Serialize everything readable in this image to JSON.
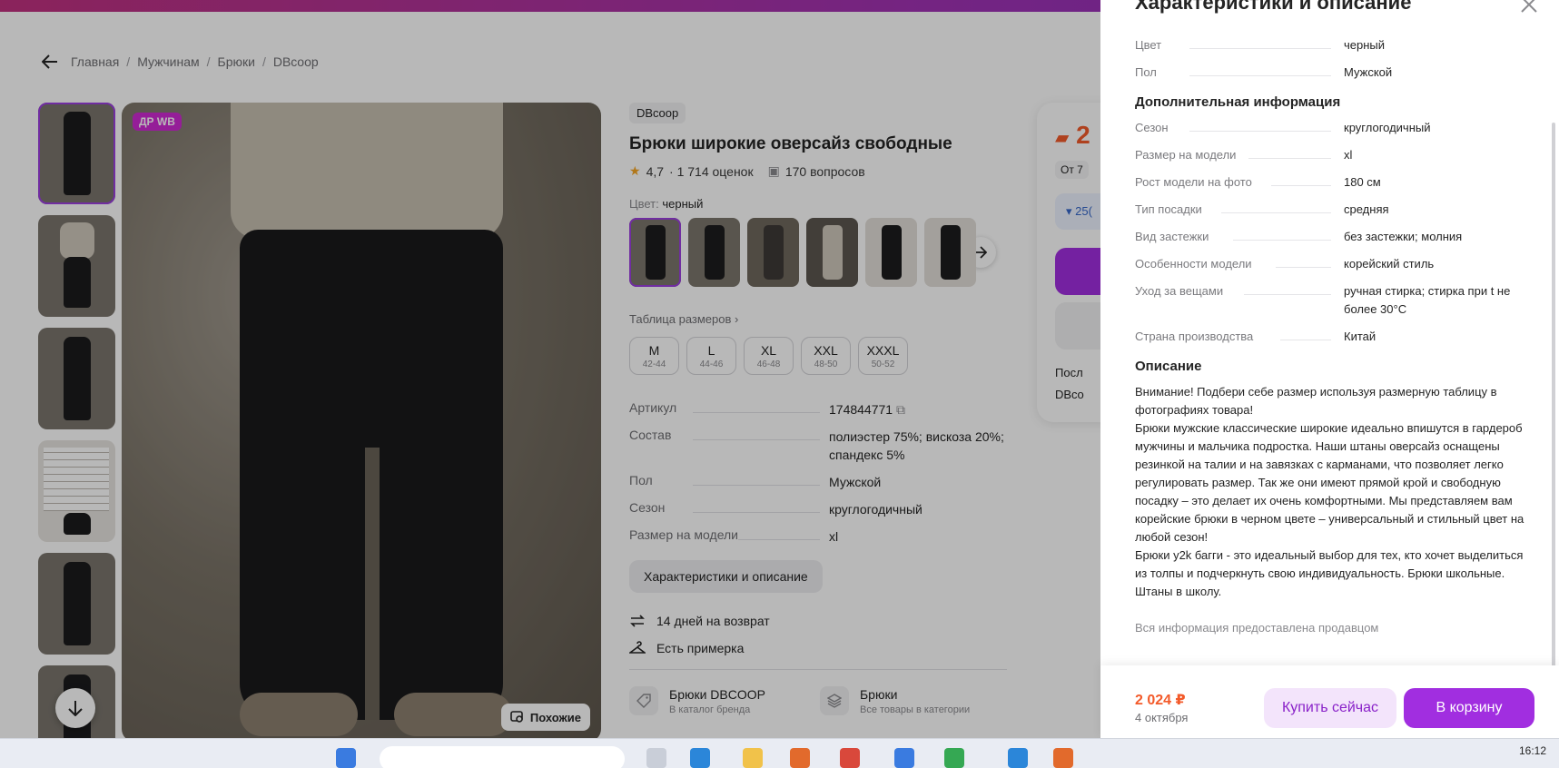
{
  "breadcrumb": [
    "Главная",
    "Мужчинам",
    "Брюки",
    "DBcoop"
  ],
  "gallery": {
    "badge": "ДР WB",
    "similar_label": "Похожие"
  },
  "product": {
    "brand": "DBcoop",
    "title": "Брюки широкие оверсайз свободные",
    "rating": "4,7",
    "reviews": "· 1 714 оценок",
    "questions": "170 вопросов",
    "color_label": "Цвет:",
    "color_value": "черный",
    "size_table_link": "Таблица размеров ›",
    "sizes": [
      {
        "s": "M",
        "r": "42-44"
      },
      {
        "s": "L",
        "r": "44-46"
      },
      {
        "s": "XL",
        "r": "46-48"
      },
      {
        "s": "XXL",
        "r": "48-50"
      },
      {
        "s": "XXXL",
        "r": "50-52"
      }
    ],
    "specs": [
      {
        "k": "Артикул",
        "v": "174844771"
      },
      {
        "k": "Состав",
        "v": "полиэстер 75%; вискоза 20%; спандекс 5%"
      },
      {
        "k": "Пол",
        "v": "Мужской"
      },
      {
        "k": "Сезон",
        "v": "круглогодичный"
      },
      {
        "k": "Размер на модели",
        "v": "xl"
      }
    ],
    "char_button": "Характеристики и описание",
    "perks": [
      "14 дней на возврат",
      "Есть примерка"
    ],
    "categories": [
      {
        "t1": "Брюки DBCOOP",
        "t2": "В каталог бренда"
      },
      {
        "t1": "Брюки",
        "t2": "Все товары в категории"
      }
    ]
  },
  "buybox": {
    "price_partial": "2",
    "from_partial": "От 7",
    "drop_partial": "▾ 25(",
    "meta1": "Посл",
    "meta2": "DBco"
  },
  "panel": {
    "title": "Характеристики и описание",
    "top_rows": [
      {
        "k": "Цвет",
        "v": "черный"
      },
      {
        "k": "Пол",
        "v": "Мужской"
      }
    ],
    "extra_title": "Дополнительная информация",
    "extra_rows": [
      {
        "k": "Сезон",
        "v": "круглогодичный"
      },
      {
        "k": "Размер на модели",
        "v": "xl"
      },
      {
        "k": "Рост модели на фото",
        "v": "180 см"
      },
      {
        "k": "Тип посадки",
        "v": "средняя"
      },
      {
        "k": "Вид застежки",
        "v": "без застежки; молния"
      },
      {
        "k": "Особенности модели",
        "v": "корейский стиль"
      },
      {
        "k": "Уход за вещами",
        "v": "ручная стирка; стирка при t не более 30°C"
      },
      {
        "k": "Страна производства",
        "v": "Китай"
      }
    ],
    "desc_title": "Описание",
    "description": "Внимание! Подбери себе размер используя размерную таблицу в фотографиях товара!\nБрюки мужские классические широкие идеально впишутся в гардероб мужчины и мальчика подростка. Наши штаны оверсайз оснащены резинкой на талии и на завязках с карманами, что позволяет легко регулировать размер. Так же они имеют прямой крой и свободную посадку – это делает их очень комфортными. Мы представляем вам корейские брюки в черном цвете – универсальный и стильный цвет на любой сезон!\nБрюки y2k багги - это идеальный выбор для тех, кто хочет выделиться из толпы и подчеркнуть свою индивидуальность. Брюки школьные. Штаны в школу.",
    "note": "Вся информация предоставлена продавцом",
    "footer": {
      "price": "2 024 ₽",
      "date": "4 октября",
      "buy_now": "Купить сейчас",
      "to_cart": "В корзину"
    }
  },
  "taskbar": {
    "clock": "16:12"
  },
  "colors": {
    "accent": "#a12ee0",
    "price": "#f35a2a",
    "badge": "#cf2ad3"
  }
}
